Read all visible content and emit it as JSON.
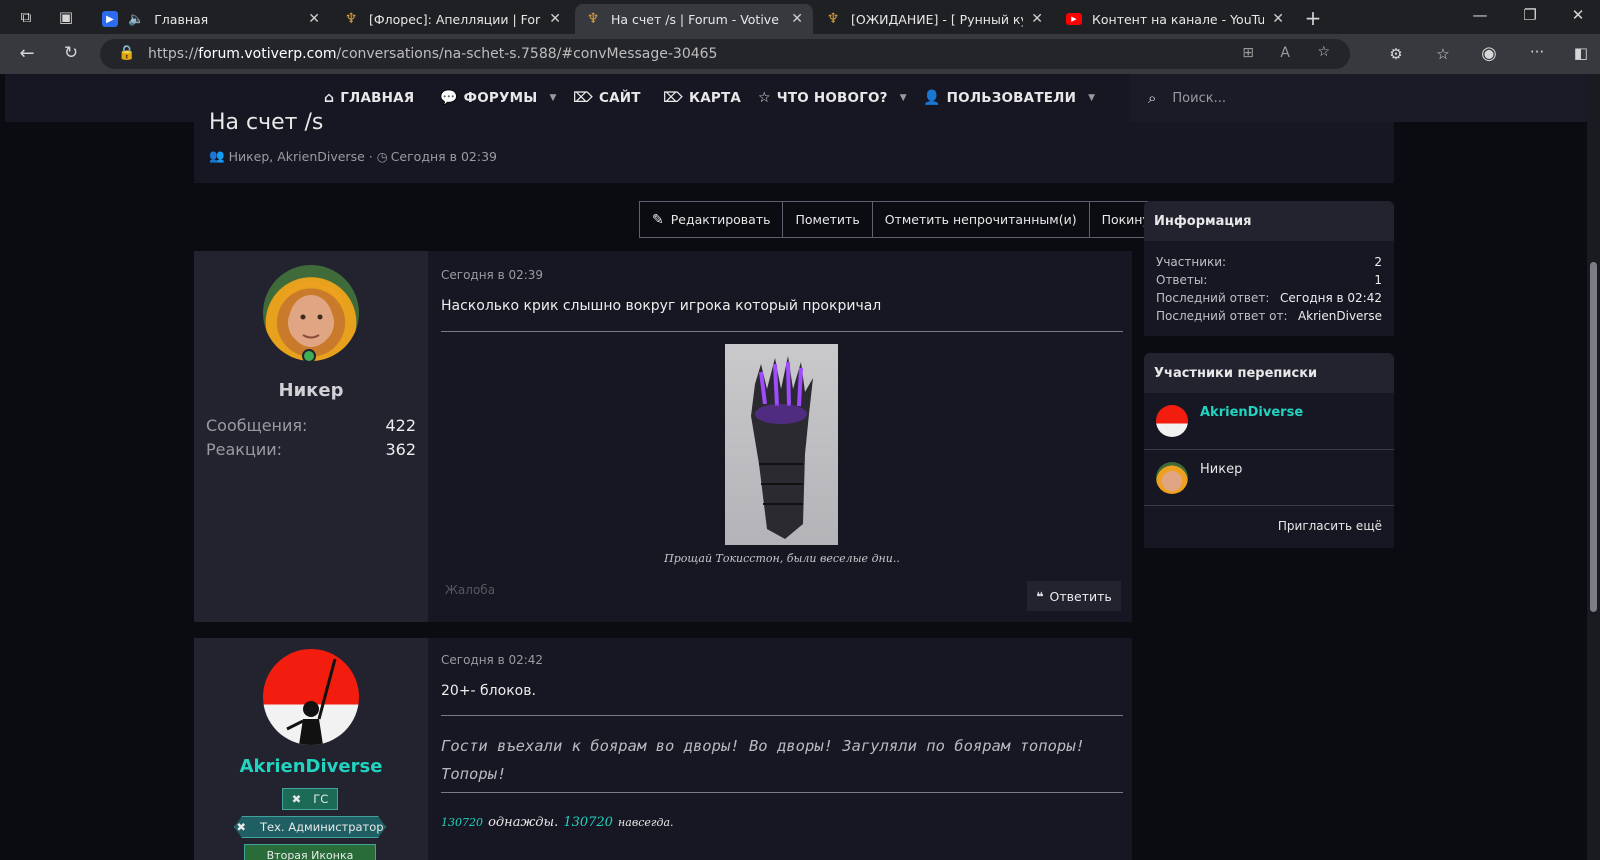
{
  "browser": {
    "tabs": [
      {
        "label": "Главная",
        "favicon": "media-icon",
        "active": false
      },
      {
        "label": "[Флорес]: Апелляции | Forum - V",
        "favicon": "votive-icon",
        "active": false
      },
      {
        "label": "На счет /s | Forum - Votive Role P",
        "favicon": "votive-icon",
        "active": true
      },
      {
        "label": "[ОЖИДАНИЕ] - [ Рунный кузнец",
        "favicon": "votive-icon",
        "active": false
      },
      {
        "label": "Контент на канале - YouTube Stu",
        "favicon": "youtube-icon",
        "active": false
      }
    ],
    "url_prefix": "https://",
    "url_host": "forum.votiverp.com",
    "url_path": "/conversations/na-schet-s.7588/#convMessage-30465"
  },
  "nav": {
    "home": "ГЛАВНАЯ",
    "forums": "ФОРУМЫ",
    "site": "САЙТ",
    "map": "КАРТА",
    "whats_new": "ЧТО НОВОГО?",
    "users": "ПОЛЬЗОВАТЕЛИ",
    "search_placeholder": "Поиск..."
  },
  "thread": {
    "title": "На счет /s",
    "participants": "Никер, AkrienDiverse",
    "separator": "·",
    "date": "Сегодня в 02:39"
  },
  "actions": {
    "edit": "Редактировать",
    "mark": "Пометить",
    "mark_unread": "Отметить непрочитанным(и)",
    "leave": "Покинуть"
  },
  "posts": [
    {
      "author": "Никер",
      "stats": [
        {
          "label": "Сообщения:",
          "value": "422"
        },
        {
          "label": "Реакции:",
          "value": "362"
        }
      ],
      "date": "Сегодня в 02:39",
      "text": "Насколько крик слышно вокруг игрока который прокричал",
      "caption": "Прощай Токисстон, были веселые дни..",
      "report": "Жалоба",
      "reply": "Ответить"
    },
    {
      "author": "AkrienDiverse",
      "badges": [
        "ГС",
        "Тех. Администратор",
        "Вторая Иконка"
      ],
      "date": "Сегодня в 02:42",
      "text": "20+- блоков.",
      "signature": "Гости въехали к боярам во дворы! Во дворы! Загуляли по боярам топоры! Топоры!",
      "sig2_num1": "130720",
      "sig2_word1": "однажды.",
      "sig2_num2": "130720",
      "sig2_word2": "навсегда."
    }
  ],
  "sidebar": {
    "info_title": "Информация",
    "info_rows": [
      {
        "label": "Участники:",
        "value": "2"
      },
      {
        "label": "Ответы:",
        "value": "1"
      },
      {
        "label": "Последний ответ:",
        "value": "Сегодня в 02:42"
      },
      {
        "label": "Последний ответ от:",
        "value": "AkrienDiverse"
      }
    ],
    "participants_title": "Участники переписки",
    "participants": [
      "AkrienDiverse",
      "Никер"
    ],
    "invite": "Пригласить ещё"
  },
  "colors": {
    "accent_teal": "#22d3c0",
    "background": "#0b0c11",
    "panel": "#161722"
  }
}
